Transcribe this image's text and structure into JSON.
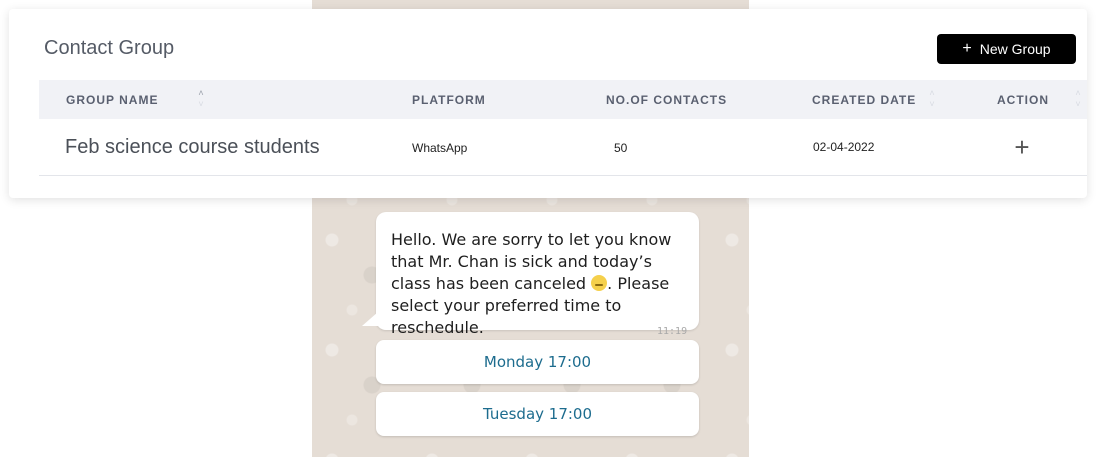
{
  "card": {
    "title": "Contact Group",
    "new_group_label": "New Group",
    "new_group_icon": "plus-icon"
  },
  "table": {
    "headers": {
      "group_name": "GROUP NAME",
      "platform": "PLATFORM",
      "contacts": "NO.OF CONTACTS",
      "created_date": "CREATED DATE",
      "action": "ACTION"
    },
    "rows": [
      {
        "group_name": "Feb science course students",
        "platform": "WhatsApp",
        "contacts": "50",
        "created_date": "02-04-2022",
        "action_icon": "plus-icon"
      }
    ]
  },
  "chat": {
    "message_part1": "Hello. We are sorry to let you know that Mr. Chan is sick and today’s class has been canceled ",
    "emoji": "sad-face-emoji",
    "message_part2": ". Please select your preferred time to reschedule.",
    "time": "11:19",
    "options": [
      "Monday 17:00",
      "Tuesday 17:00"
    ]
  },
  "colors": {
    "chat_background": "#e5ddd5",
    "button_text": "#1d6c8e",
    "primary_button": "#000000"
  }
}
